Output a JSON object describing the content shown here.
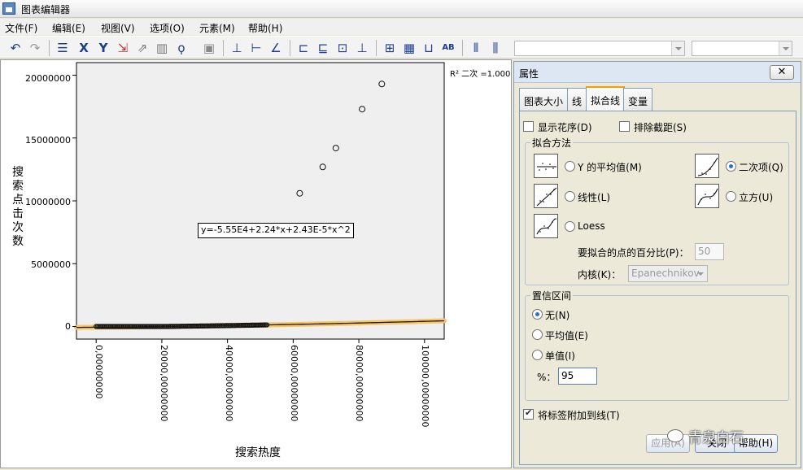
{
  "window": {
    "title": "图表编辑器"
  },
  "menu": [
    "文件(F)",
    "编辑(E)",
    "视图(V)",
    "选项(O)",
    "元素(M)",
    "帮助(H)"
  ],
  "toolbar": {
    "icons": [
      "undo-icon",
      "redo-icon",
      "properties-icon",
      "x-axis-icon",
      "y-axis-icon",
      "scale-icon",
      "transpose-icon",
      "bar-chart-icon",
      "lasso-icon",
      "image-icon",
      "fit-line-total-icon",
      "fit-line-subgroup-icon",
      "interpolation-line-icon",
      "title-icon",
      "legend-icon",
      "textbox-icon",
      "footnote-icon",
      "grid-icon",
      "table-icon",
      "data-label-icon",
      "data-label-mode-icon",
      "bar-icon",
      "line-icon"
    ]
  },
  "chart": {
    "r2_label": "R² 二次 =1.000",
    "equation": "y=-5.55E4+2.24*x+2.43E-5*x^2",
    "ylabel": "搜索点击次数",
    "xlabel": "搜索热度",
    "yticks": [
      "20000000",
      "15000000",
      "10000000",
      "5000000",
      "0"
    ],
    "xticks": [
      "0,00000000",
      "20000,00000000",
      "40000,00000000",
      "60000,00000000",
      "80000,00000000",
      "100000,00000000"
    ]
  },
  "chart_data": {
    "type": "scatter",
    "title": "",
    "xlabel": "搜索热度",
    "ylabel": "搜索点击次数",
    "xlim": [
      -6000,
      106000
    ],
    "ylim": [
      -1000000,
      21000000
    ],
    "fit": {
      "a": -55500,
      "b": 2.24,
      "c": 2.43e-05,
      "label": "y=-5.55E4+2.24*x+2.43E-5*x^2"
    },
    "highlight_points": [
      {
        "x": 62000,
        "y": 10600000
      },
      {
        "x": 69000,
        "y": 12700000
      },
      {
        "x": 73000,
        "y": 14200000
      },
      {
        "x": 81000,
        "y": 17300000
      },
      {
        "x": 87000,
        "y": 19300000
      }
    ],
    "grid": false
  },
  "panel": {
    "title": "属性",
    "close_label": "✕",
    "tabs": [
      "图表大小",
      "线",
      "拟合线",
      "变量"
    ],
    "show_rug_label": "显示花序(D)",
    "exclude_intercept_label": "排除截距(S)",
    "fit_method_title": "拟合方法",
    "methods": {
      "mean": "Y 的平均值(M)",
      "linear": "线性(L)",
      "loess": "Loess",
      "quadratic": "二次项(Q)",
      "cubic": "立方(U)"
    },
    "selected_method": "quadratic",
    "percent_label": "要拟合的点的百分比(P)：",
    "percent_value": "50",
    "kernel_label": "内核(K)：",
    "kernel_value": "Epanechnikov",
    "ci_title": "置信区间",
    "ci_options": {
      "none": "无(N)",
      "mean": "平均值(E)",
      "individual": "单值(I)"
    },
    "ci_selected": "none",
    "pct_label": "%：",
    "pct_value": "95",
    "attach_label": "将标签附加到线(T)",
    "attach_checked": true,
    "apply_label": "应用(A)",
    "close_button": "关闭",
    "help_button": "帮助(H)"
  },
  "watermark": "青泉白石",
  "colors": {
    "fitline": "#1a1a1a",
    "fitglow": "#f7c563",
    "plotbg": "#efefef"
  }
}
